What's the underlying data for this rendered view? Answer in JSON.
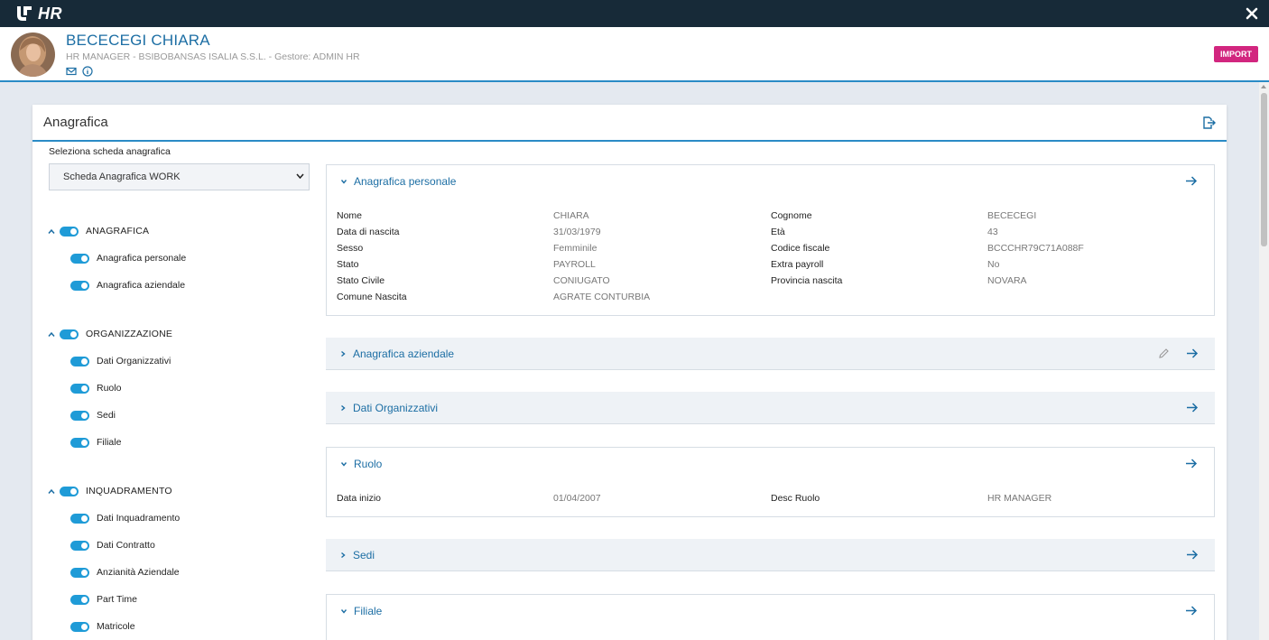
{
  "app": {
    "name": "HR"
  },
  "employee": {
    "name": "BECECEGI CHIARA",
    "subtitle": "HR MANAGER - BSIBOBANSAS ISALIA S.S.L. - Gestore: ADMIN HR"
  },
  "header": {
    "import_label": "IMPORT"
  },
  "card": {
    "title": "Anagrafica"
  },
  "selector": {
    "label": "Seleziona scheda anagrafica",
    "value": "Scheda Anagrafica WORK"
  },
  "tree": {
    "groups": [
      {
        "label": "ANAGRAFICA",
        "items": [
          "Anagrafica personale",
          "Anagrafica aziendale"
        ]
      },
      {
        "label": "ORGANIZZAZIONE",
        "items": [
          "Dati Organizzativi",
          "Ruolo",
          "Sedi",
          "Filiale"
        ]
      },
      {
        "label": "INQUADRAMENTO",
        "items": [
          "Dati Inquadramento",
          "Dati Contratto",
          "Anzianità Aziendale",
          "Part Time",
          "Matricole"
        ]
      }
    ]
  },
  "panels": {
    "personale": {
      "title": "Anagrafica personale",
      "fields": [
        {
          "label": "Nome",
          "value": "CHIARA"
        },
        {
          "label": "Cognome",
          "value": "BECECEGI"
        },
        {
          "label": "Data di nascita",
          "value": "31/03/1979"
        },
        {
          "label": "Età",
          "value": "43"
        },
        {
          "label": "Sesso",
          "value": "Femminile"
        },
        {
          "label": "Codice fiscale",
          "value": "BCCCHR79C71A088F"
        },
        {
          "label": "Stato",
          "value": "PAYROLL"
        },
        {
          "label": "Extra payroll",
          "value": "No"
        },
        {
          "label": "Stato Civile",
          "value": "CONIUGATO"
        },
        {
          "label": "Provincia nascita",
          "value": "NOVARA"
        },
        {
          "label": "Comune Nascita",
          "value": "AGRATE CONTURBIA"
        }
      ]
    },
    "aziendale": {
      "title": "Anagrafica aziendale"
    },
    "organizzativi": {
      "title": "Dati Organizzativi"
    },
    "ruolo": {
      "title": "Ruolo",
      "fields": [
        {
          "label": "Data inizio",
          "value": "01/04/2007"
        },
        {
          "label": "Desc Ruolo",
          "value": "HR MANAGER"
        }
      ]
    },
    "sedi": {
      "title": "Sedi"
    },
    "filiale": {
      "title": "Filiale"
    }
  },
  "colors": {
    "topbar": "#172a38",
    "accent": "#2a8bc6",
    "title": "#1c6ea4",
    "import": "#d2267f",
    "toggle": "#1f9bd7"
  }
}
